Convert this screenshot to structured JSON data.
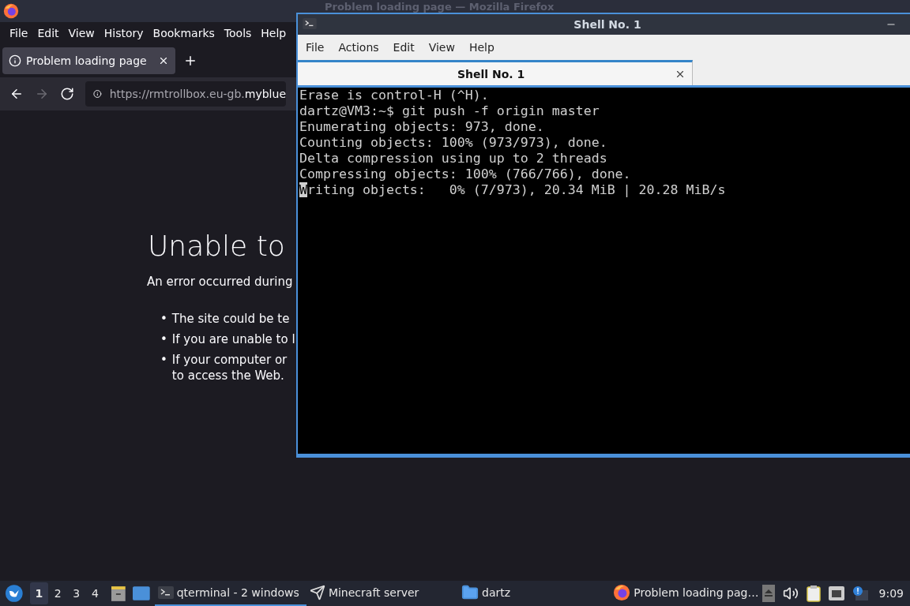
{
  "firefox": {
    "title": "Problem loading page — Mozilla Firefox",
    "menu": [
      "File",
      "Edit",
      "View",
      "History",
      "Bookmarks",
      "Tools",
      "Help"
    ],
    "tabs": [
      {
        "label": "Problem loading page",
        "selected": true
      }
    ],
    "url": "https://rmtrollbox.eu-gb.**myblue**",
    "back_disabled": false,
    "forward_disabled": true,
    "heading": "Unable to",
    "description": "An error occurred during",
    "bullets": [
      {
        "marker": "•",
        "lines": [
          "The site could be te"
        ]
      },
      {
        "marker": "•",
        "lines": [
          "If you are unable to l"
        ]
      },
      {
        "marker": "•",
        "lines": [
          "If your computer or",
          "to access the Web."
        ]
      }
    ]
  },
  "terminal": {
    "title": "Shell No. 1",
    "menu": [
      "File",
      "Actions",
      "Edit",
      "View",
      "Help"
    ],
    "tabs": [
      {
        "label": "Shell No. 1",
        "selected": true
      }
    ],
    "lines": [
      {
        "text": "Erase is control-H (^H).",
        "cursor": false
      },
      {
        "text": "dartz@VM3:~$ git push -f origin master",
        "cursor": false
      },
      {
        "text": "Enumerating objects: 973, done.",
        "cursor": false
      },
      {
        "text": "Counting objects: 100% (973/973), done.",
        "cursor": false
      },
      {
        "text": "Delta compression using up to 2 threads",
        "cursor": false
      },
      {
        "text": "Compressing objects: 100% (766/766), done.",
        "cursor": false
      },
      {
        "text": "Writing objects:   0% (7/973), 20.34 MiB | 20.28 MiB/s",
        "cursor": true
      }
    ]
  },
  "taskbar": {
    "workspaces": [
      {
        "label": "1",
        "selected": true
      },
      {
        "label": "2",
        "selected": false
      },
      {
        "label": "3",
        "selected": false
      },
      {
        "label": "4",
        "selected": false
      }
    ],
    "tasks": [
      {
        "label": "qterminal - 2 windows",
        "kind": "terminal",
        "selected": true
      },
      {
        "label": "Minecraft server",
        "kind": "plane",
        "selected": false
      },
      {
        "label": "dartz",
        "kind": "folder",
        "selected": false
      },
      {
        "label": "Problem loading pag…",
        "kind": "firefox",
        "selected": false
      }
    ],
    "clock": "9:09"
  }
}
